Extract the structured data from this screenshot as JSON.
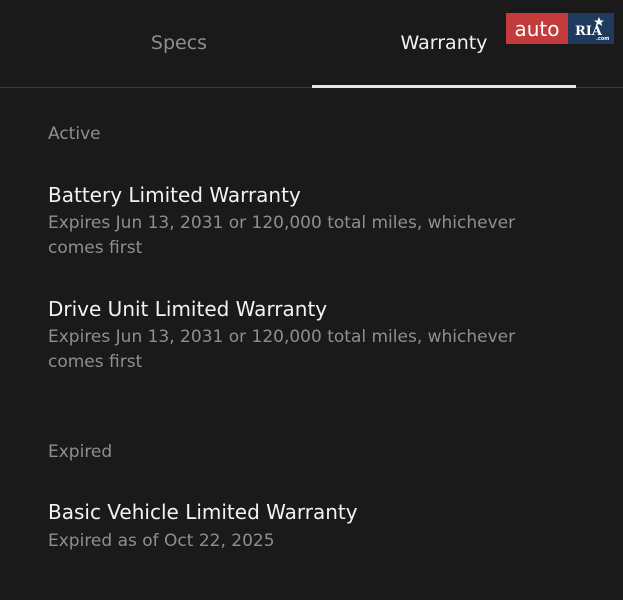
{
  "tabs": {
    "specs_label": "Specs",
    "warranty_label": "Warranty",
    "active_tab": "Warranty"
  },
  "logo": {
    "auto_text": "auto",
    "ria_text": "RIA",
    "com_text": ".com"
  },
  "sections": {
    "active": {
      "label": "Active",
      "items": [
        {
          "title": "Battery Limited Warranty",
          "subtitle": "Expires Jun 13, 2031 or 120,000 total miles, whichever comes first"
        },
        {
          "title": "Drive Unit Limited Warranty",
          "subtitle": "Expires Jun 13, 2031 or 120,000 total miles, whichever comes first"
        }
      ]
    },
    "expired": {
      "label": "Expired",
      "items": [
        {
          "title": "Basic Vehicle Limited Warranty",
          "subtitle": "Expired as of Oct 22, 2025"
        }
      ]
    }
  },
  "colors": {
    "background": "#1a1a1b",
    "primary_text": "#f2f2f2",
    "secondary_text": "#8e8e93",
    "logo_red": "#c33b3b",
    "logo_blue": "#1e3a5f"
  }
}
